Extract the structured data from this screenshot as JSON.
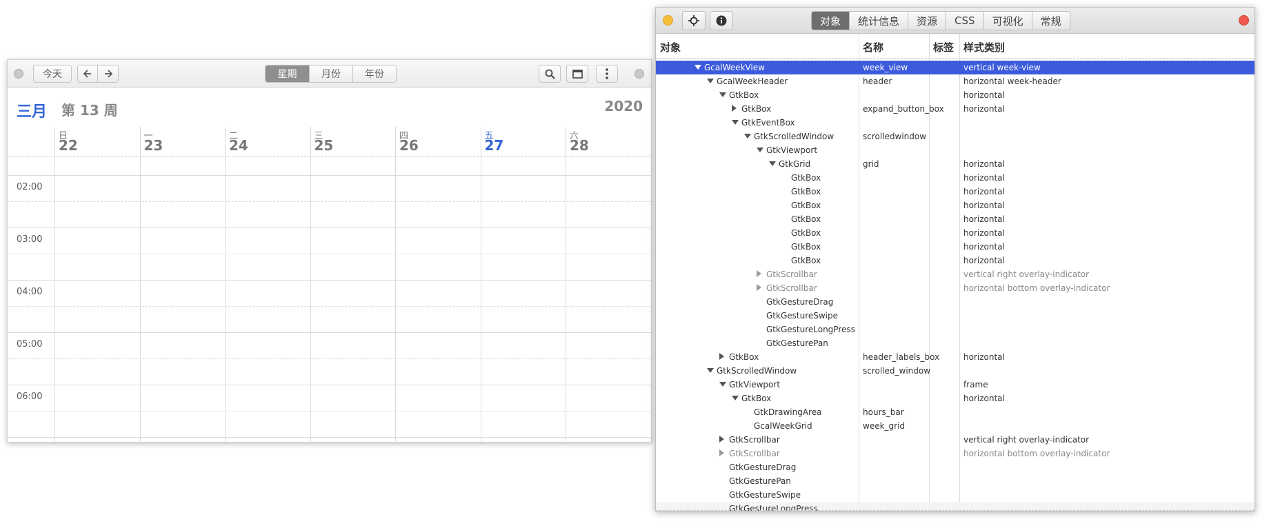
{
  "calendar": {
    "toolbar": {
      "today_label": "今天",
      "prev_icon": "arrow-left-icon",
      "next_icon": "arrow-right-icon",
      "views": [
        {
          "label": "星期",
          "active": true
        },
        {
          "label": "月份",
          "active": false
        },
        {
          "label": "年份",
          "active": false
        }
      ],
      "search_icon": "search-icon",
      "window_icon": "window-icon",
      "menu_icon": "menu-icon"
    },
    "header": {
      "month": "三月",
      "week": "第 13 周",
      "year": "2020"
    },
    "days": [
      {
        "weekday": "日",
        "date": "22",
        "today": false
      },
      {
        "weekday": "一",
        "date": "23",
        "today": false
      },
      {
        "weekday": "二",
        "date": "24",
        "today": false
      },
      {
        "weekday": "三",
        "date": "25",
        "today": false
      },
      {
        "weekday": "四",
        "date": "26",
        "today": false
      },
      {
        "weekday": "五",
        "date": "27",
        "today": true
      },
      {
        "weekday": "六",
        "date": "28",
        "today": false
      }
    ],
    "hours": [
      "02:00",
      "03:00",
      "04:00",
      "05:00",
      "06:00"
    ],
    "accent": "#3465d8"
  },
  "inspector": {
    "tabs": [
      {
        "label": "对象",
        "active": true
      },
      {
        "label": "统计信息",
        "active": false
      },
      {
        "label": "资源",
        "active": false
      },
      {
        "label": "CSS",
        "active": false
      },
      {
        "label": "可视化",
        "active": false
      },
      {
        "label": "常规",
        "active": false
      }
    ],
    "columns": {
      "object": "对象",
      "name": "名称",
      "label": "标签",
      "style": "样式类别"
    },
    "selection_color": "#3c5bdc",
    "rows": [
      {
        "depth": 0,
        "exp": "open",
        "type": "GcalWeekView",
        "name": "week_view",
        "style": "vertical week-view",
        "selected": true
      },
      {
        "depth": 1,
        "exp": "open",
        "type": "GcalWeekHeader",
        "name": "header",
        "style": "horizontal week-header"
      },
      {
        "depth": 2,
        "exp": "open",
        "type": "GtkBox",
        "name": "",
        "style": "horizontal"
      },
      {
        "depth": 3,
        "exp": "closed",
        "type": "GtkBox",
        "name": "expand_button_box",
        "style": "horizontal"
      },
      {
        "depth": 3,
        "exp": "open",
        "type": "GtkEventBox",
        "name": "",
        "style": ""
      },
      {
        "depth": 4,
        "exp": "open",
        "type": "GtkScrolledWindow",
        "name": "scrolledwindow",
        "style": ""
      },
      {
        "depth": 5,
        "exp": "open",
        "type": "GtkViewport",
        "name": "",
        "style": ""
      },
      {
        "depth": 6,
        "exp": "open",
        "type": "GtkGrid",
        "name": "grid",
        "style": "horizontal"
      },
      {
        "depth": 7,
        "exp": "",
        "type": "GtkBox",
        "name": "",
        "style": "horizontal"
      },
      {
        "depth": 7,
        "exp": "",
        "type": "GtkBox",
        "name": "",
        "style": "horizontal"
      },
      {
        "depth": 7,
        "exp": "",
        "type": "GtkBox",
        "name": "",
        "style": "horizontal"
      },
      {
        "depth": 7,
        "exp": "",
        "type": "GtkBox",
        "name": "",
        "style": "horizontal"
      },
      {
        "depth": 7,
        "exp": "",
        "type": "GtkBox",
        "name": "",
        "style": "horizontal"
      },
      {
        "depth": 7,
        "exp": "",
        "type": "GtkBox",
        "name": "",
        "style": "horizontal"
      },
      {
        "depth": 7,
        "exp": "",
        "type": "GtkBox",
        "name": "",
        "style": "horizontal"
      },
      {
        "depth": 5,
        "exp": "closed",
        "type": "GtkScrollbar",
        "name": "",
        "style": "vertical right overlay-indicator",
        "dim": true
      },
      {
        "depth": 5,
        "exp": "closed",
        "type": "GtkScrollbar",
        "name": "",
        "style": "horizontal bottom overlay-indicator",
        "dim": true
      },
      {
        "depth": 5,
        "exp": "",
        "type": "GtkGestureDrag",
        "name": "",
        "style": ""
      },
      {
        "depth": 5,
        "exp": "",
        "type": "GtkGestureSwipe",
        "name": "",
        "style": ""
      },
      {
        "depth": 5,
        "exp": "",
        "type": "GtkGestureLongPress",
        "name": "",
        "style": ""
      },
      {
        "depth": 5,
        "exp": "",
        "type": "GtkGesturePan",
        "name": "",
        "style": ""
      },
      {
        "depth": 2,
        "exp": "closed",
        "type": "GtkBox",
        "name": "header_labels_box",
        "style": "horizontal"
      },
      {
        "depth": 1,
        "exp": "open",
        "type": "GtkScrolledWindow",
        "name": "scrolled_window",
        "style": ""
      },
      {
        "depth": 2,
        "exp": "open",
        "type": "GtkViewport",
        "name": "",
        "style": "frame"
      },
      {
        "depth": 3,
        "exp": "open",
        "type": "GtkBox",
        "name": "",
        "style": "horizontal"
      },
      {
        "depth": 4,
        "exp": "",
        "type": "GtkDrawingArea",
        "name": "hours_bar",
        "style": ""
      },
      {
        "depth": 4,
        "exp": "",
        "type": "GcalWeekGrid",
        "name": "week_grid",
        "style": ""
      },
      {
        "depth": 2,
        "exp": "closed",
        "type": "GtkScrollbar",
        "name": "",
        "style": "vertical right overlay-indicator"
      },
      {
        "depth": 2,
        "exp": "closed",
        "type": "GtkScrollbar",
        "name": "",
        "style": "horizontal bottom overlay-indicator",
        "dim": true
      },
      {
        "depth": 2,
        "exp": "",
        "type": "GtkGestureDrag",
        "name": "",
        "style": ""
      },
      {
        "depth": 2,
        "exp": "",
        "type": "GtkGesturePan",
        "name": "",
        "style": ""
      },
      {
        "depth": 2,
        "exp": "",
        "type": "GtkGestureSwipe",
        "name": "",
        "style": ""
      },
      {
        "depth": 2,
        "exp": "",
        "type": "GtkGestureLongPress",
        "name": "",
        "style": "",
        "last": true
      }
    ]
  }
}
